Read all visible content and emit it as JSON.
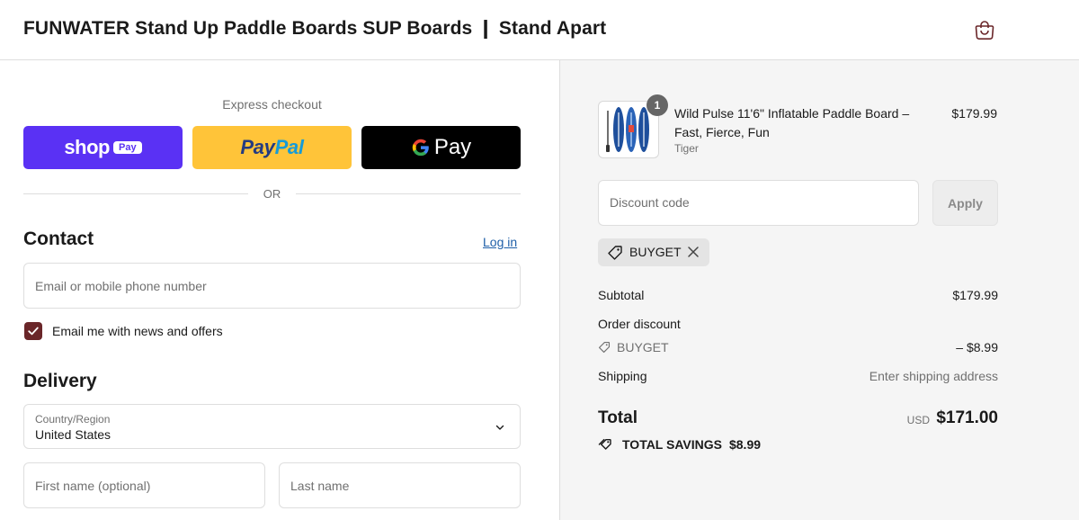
{
  "header": {
    "store_name": "FUNWATER Stand Up Paddle Boards SUP Boards ❙ Stand Apart",
    "cart_icon": "shopping-bag-icon"
  },
  "express": {
    "label": "Express checkout",
    "shop_word": "shop",
    "shop_pill": "Pay",
    "paypal_pay": "Pay",
    "paypal_pal": "Pal",
    "gpay_g": "G",
    "gpay_word": "Pay",
    "or_text": "OR"
  },
  "contact": {
    "heading": "Contact",
    "login_link": "Log in",
    "email_placeholder": "Email or mobile phone number",
    "newsletter_label": "Email me with news and offers",
    "newsletter_checked": true
  },
  "delivery": {
    "heading": "Delivery",
    "country_label": "Country/Region",
    "country_value": "United States",
    "first_name_placeholder": "First name (optional)",
    "last_name_placeholder": "Last name"
  },
  "summary": {
    "product": {
      "quantity": "1",
      "title": "Wild Pulse 11'6\" Inflatable Paddle Board – Fast, Fierce, Fun",
      "variant": "Tiger",
      "price": "$179.99"
    },
    "discount_placeholder": "Discount code",
    "apply_label": "Apply",
    "applied_code": "BUYGET",
    "subtotal_label": "Subtotal",
    "subtotal_value": "$179.99",
    "order_discount_label": "Order discount",
    "order_discount_code": "BUYGET",
    "order_discount_value": "– $8.99",
    "shipping_label": "Shipping",
    "shipping_value": "Enter shipping address",
    "total_label": "Total",
    "total_currency": "USD",
    "total_value": "$171.00",
    "savings_label": "TOTAL SAVINGS",
    "savings_value": "$8.99"
  },
  "colors": {
    "shop_pay": "#5a31f4",
    "paypal": "#ffc439",
    "gpay": "#000000",
    "checkbox": "#6a2629",
    "link": "#1f5fa8"
  }
}
